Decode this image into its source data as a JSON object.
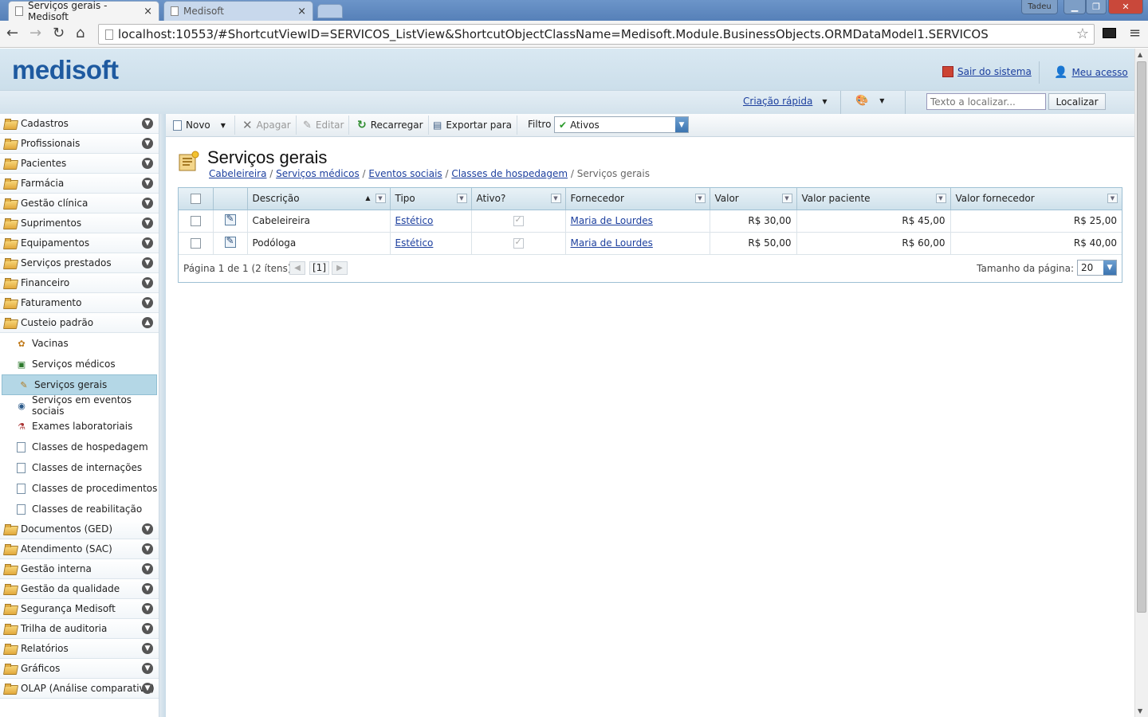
{
  "browser": {
    "tabs": [
      {
        "title": "Serviços gerais - Medisoft",
        "close": "×"
      },
      {
        "title": "Medisoft",
        "close": "×"
      }
    ],
    "user_badge": "Tadeu",
    "url": "localhost:10553/#ShortcutViewID=SERVICOS_ListView&ShortcutObjectClassName=Medisoft.Module.BusinessObjects.ORMDataModel1.SERVICOS"
  },
  "header": {
    "logo": "medisoft",
    "logout": "Sair do sistema",
    "my_access": "Meu acesso",
    "quick_create": "Criação rápida",
    "search_placeholder": "Texto a localizar...",
    "search_button": "Localizar"
  },
  "sidebar": {
    "groups_top": [
      {
        "label": "Cadastros"
      },
      {
        "label": "Profissionais"
      },
      {
        "label": "Pacientes"
      },
      {
        "label": "Farmácia"
      },
      {
        "label": "Gestão clínica"
      },
      {
        "label": "Suprimentos"
      },
      {
        "label": "Equipamentos"
      },
      {
        "label": "Serviços prestados"
      },
      {
        "label": "Financeiro"
      },
      {
        "label": "Faturamento"
      }
    ],
    "expanded_group": {
      "label": "Custeio padrão"
    },
    "items": [
      {
        "label": "Vacinas",
        "icon": "vaccine-icon"
      },
      {
        "label": "Serviços médicos",
        "icon": "medical-doc-icon"
      },
      {
        "label": "Serviços gerais",
        "icon": "general-services-icon",
        "selected": true
      },
      {
        "label": "Serviços em eventos sociais",
        "icon": "eye-icon"
      },
      {
        "label": "Exames laboratoriais",
        "icon": "lab-icon"
      },
      {
        "label": "Classes de hospedagem",
        "icon": "document-icon"
      },
      {
        "label": "Classes de internações",
        "icon": "document-icon"
      },
      {
        "label": "Classes de procedimentos",
        "icon": "document-icon"
      },
      {
        "label": "Classes de reabilitação",
        "icon": "document-icon"
      }
    ],
    "groups_bottom": [
      {
        "label": "Documentos (GED)"
      },
      {
        "label": "Atendimento (SAC)"
      },
      {
        "label": "Gestão interna"
      },
      {
        "label": "Gestão da qualidade"
      },
      {
        "label": "Segurança Medisoft"
      },
      {
        "label": "Trilha de auditoria"
      },
      {
        "label": "Relatórios"
      },
      {
        "label": "Gráficos"
      },
      {
        "label": "OLAP (Análise comparativa)"
      }
    ]
  },
  "commands": {
    "new": "Novo",
    "delete": "Apagar",
    "edit": "Editar",
    "reload": "Recarregar",
    "export": "Exportar para",
    "filter_label": "Filtro",
    "filter_value": "Ativos"
  },
  "page": {
    "title": "Serviços gerais",
    "breadcrumb": [
      "Cabeleireira",
      "Serviços médicos",
      "Eventos sociais",
      "Classes de hospedagem"
    ],
    "breadcrumb_current": "Serviços gerais"
  },
  "grid": {
    "columns": [
      "Descrição",
      "Tipo",
      "Ativo?",
      "Fornecedor",
      "Valor",
      "Valor paciente",
      "Valor fornecedor"
    ],
    "rows": [
      {
        "descricao": "Cabeleireira",
        "tipo": "Estético",
        "ativo": true,
        "fornecedor": "Maria de Lourdes",
        "valor": "R$ 30,00",
        "valor_paciente": "R$ 45,00",
        "valor_fornecedor": "R$ 25,00"
      },
      {
        "descricao": "Podóloga",
        "tipo": "Estético",
        "ativo": true,
        "fornecedor": "Maria de Lourdes",
        "valor": "R$ 50,00",
        "valor_paciente": "R$ 60,00",
        "valor_fornecedor": "R$ 40,00"
      }
    ],
    "pager_info": "Página 1 de 1 (2 ítens)",
    "current_page": "[1]",
    "page_size_label": "Tamanho da página:",
    "page_size": "20"
  }
}
